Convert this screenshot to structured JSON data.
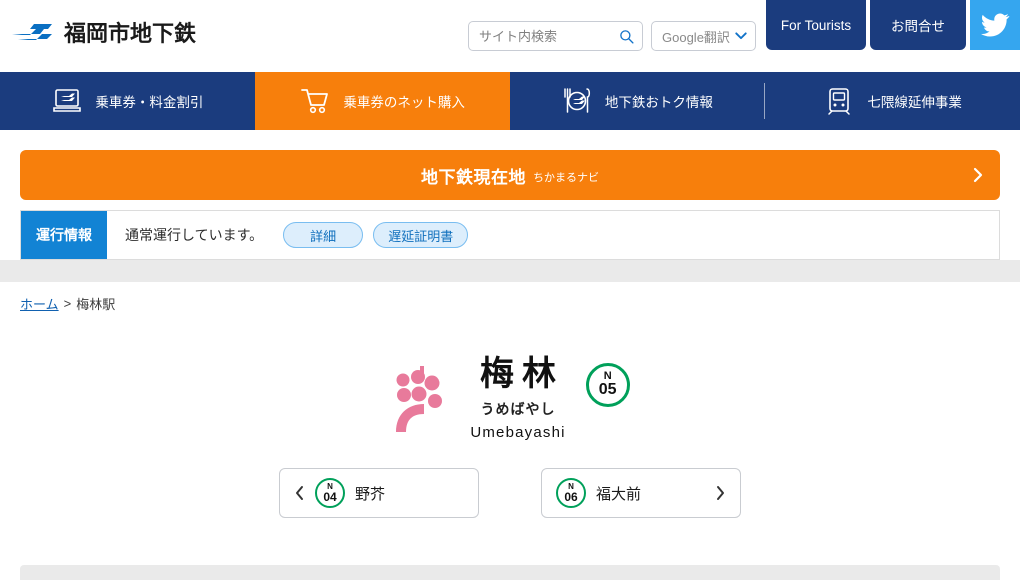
{
  "header": {
    "brand_name": "福岡市地下鉄",
    "brand_logo_icon": "fukuoka-subway-logo",
    "search": {
      "placeholder": "サイト内検索",
      "value": "",
      "icon": "search-icon"
    },
    "translate": {
      "label": "Google翻訳",
      "icon": "chevron-down-icon"
    },
    "tourists_label": "For Tourists",
    "contact_label": "お問合せ",
    "twitter_icon": "twitter-bird-icon"
  },
  "navbar": {
    "items": [
      {
        "label": "乗車券・料金割引",
        "icon": "ticket-icon",
        "active": false
      },
      {
        "label": "乗車券のネット購入",
        "icon": "shopping-cart-icon",
        "active": true
      },
      {
        "label": "地下鉄おトク情報",
        "icon": "dining-plate-icon",
        "active": false
      },
      {
        "label": "七隈線延伸事業",
        "icon": "train-front-icon",
        "active": false
      }
    ]
  },
  "banner": {
    "title": "地下鉄現在地",
    "subtitle": "ちかまるナビ",
    "chevron_icon": "chevron-right-icon",
    "color": "#f77f0c"
  },
  "status": {
    "badge": "運行情報",
    "badge_color": "#1283d4",
    "message": "通常運行しています。",
    "buttons": [
      {
        "label": "詳細"
      },
      {
        "label": "遅延証明書"
      }
    ]
  },
  "breadcrumb": {
    "home_label": "ホーム",
    "separator": ">",
    "current_label": "梅林駅"
  },
  "station": {
    "illustration_icon": "plum-blossom-icon",
    "illustration_color": "#e87a9b",
    "name_kanji": "梅林",
    "name_kana": "うめばやし",
    "name_roman": "Umebayashi",
    "code_letter": "N",
    "code_number": "05",
    "code_color": "#00a05a"
  },
  "adjacent": {
    "prev": {
      "arrow_icon": "chevron-left-icon",
      "code_letter": "N",
      "code_number": "04",
      "label": "野芥"
    },
    "next": {
      "arrow_icon": "chevron-right-icon",
      "code_letter": "N",
      "code_number": "06",
      "label": "福大前"
    }
  }
}
